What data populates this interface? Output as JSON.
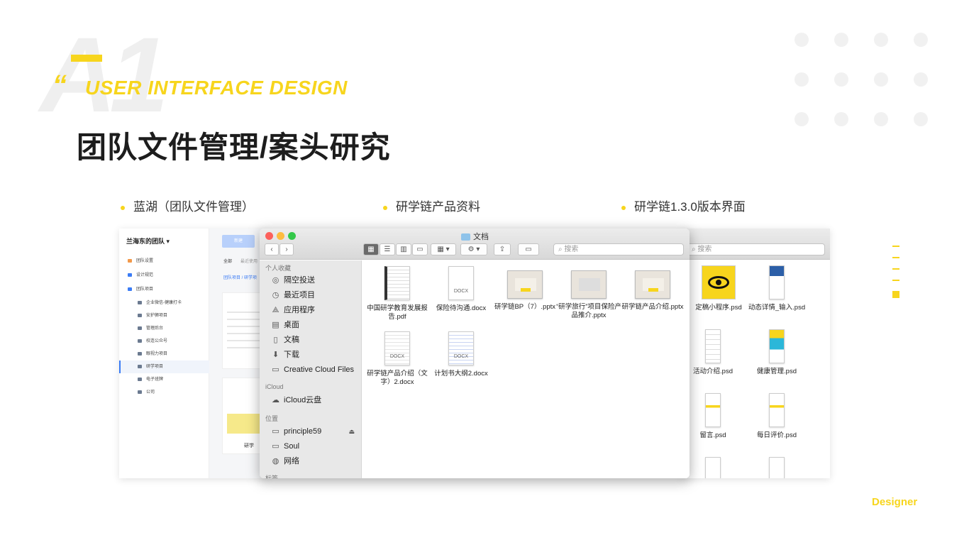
{
  "header": {
    "watermark": "A1",
    "quote_mark": "“",
    "subtitle": "USER INTERFACE DESIGN",
    "title": "团队文件管理/案头研究",
    "designer": "Designer"
  },
  "bullets": [
    "蓝湖（团队文件管理）",
    "研学链产品资料",
    "研学链1.3.0版本界面"
  ],
  "lanhu": {
    "team": "兰海东的团队 ▾",
    "new_button": "新建",
    "tabs": [
      "全部",
      "最近使用"
    ],
    "breadcrumb": "团队项目 / 研学项",
    "items": [
      {
        "label": "团队设置",
        "icon": "gear-icon"
      },
      {
        "label": "设计规范",
        "icon": "book-icon"
      },
      {
        "label": "团队项目",
        "icon": "folder-icon"
      },
      {
        "label": "企业微信-健康打卡",
        "icon": "folder-icon"
      },
      {
        "label": "安护狮项目",
        "icon": "folder-icon"
      },
      {
        "label": "管理后台",
        "icon": "folder-icon"
      },
      {
        "label": "校连公众号",
        "icon": "folder-icon"
      },
      {
        "label": "眼视力项目",
        "icon": "folder-icon"
      },
      {
        "label": "研学项目",
        "icon": "folder-icon"
      },
      {
        "label": "电子班牌",
        "icon": "folder-icon"
      },
      {
        "label": "公司",
        "icon": "folder-icon"
      }
    ],
    "card_label": "研学"
  },
  "finder": {
    "window_title": "文档",
    "search_placeholder": "搜索",
    "sidebar": {
      "favorites_label": "个人收藏",
      "favorites": [
        {
          "label": "隔空投送",
          "icon": "airdrop-icon"
        },
        {
          "label": "最近项目",
          "icon": "clock-icon"
        },
        {
          "label": "应用程序",
          "icon": "apps-icon"
        },
        {
          "label": "桌面",
          "icon": "desktop-icon"
        },
        {
          "label": "文稿",
          "icon": "document-icon"
        },
        {
          "label": "下载",
          "icon": "download-icon"
        },
        {
          "label": "Creative Cloud Files",
          "icon": "folder-icon"
        }
      ],
      "icloud_label": "iCloud",
      "icloud": [
        {
          "label": "iCloud云盘",
          "icon": "cloud-icon"
        }
      ],
      "locations_label": "位置",
      "locations": [
        {
          "label": "principle59",
          "icon": "disk-icon"
        },
        {
          "label": "Soul",
          "icon": "disk-icon"
        },
        {
          "label": "网络",
          "icon": "globe-icon"
        }
      ],
      "tags_label": "标签"
    },
    "files": [
      {
        "name": "中国研学教育发展报告.pdf",
        "kind": "pdf"
      },
      {
        "name": "保险待沟通.docx",
        "kind": "docx",
        "tag": "DOCX"
      },
      {
        "name": "研学链BP（7）.pptx",
        "kind": "pptx"
      },
      {
        "name": "“研学旅行”项目保险产品推介.pptx",
        "kind": "pptx"
      },
      {
        "name": "研学链产品介绍.pptx",
        "kind": "pptx"
      },
      {
        "name": "研学链产品介绍（文字）2.docx",
        "kind": "docx",
        "tag": "DOCX"
      },
      {
        "name": "计划书大纲2.docx",
        "kind": "docx",
        "tag": "DOCX"
      }
    ]
  },
  "psd_panel": {
    "search_placeholder": "搜索",
    "files": [
      "定稿小程序.psd",
      "动态详情_输入.psd",
      "活动介绍.psd",
      "健康管理.psd",
      "留言.psd",
      "每日评价.psd"
    ]
  },
  "colors": {
    "accent": "#f7d51d",
    "title": "#1d1d1d"
  }
}
